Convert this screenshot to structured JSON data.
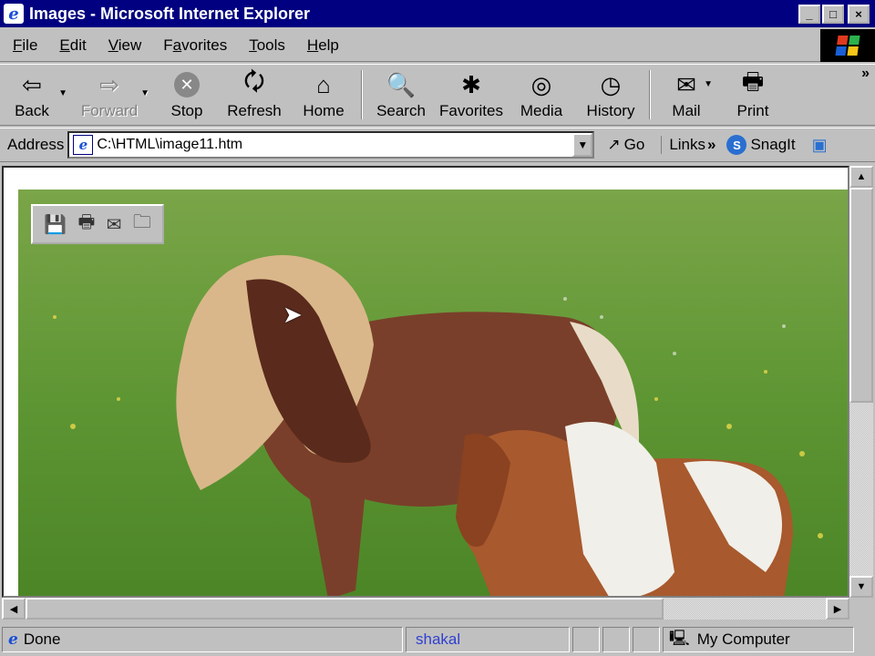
{
  "window": {
    "title": "Images - Microsoft Internet Explorer",
    "min": "_",
    "max": "□",
    "close": "×"
  },
  "menu": [
    {
      "label": "File",
      "u": "F"
    },
    {
      "label": "Edit",
      "u": "E"
    },
    {
      "label": "View",
      "u": "V"
    },
    {
      "label": "Favorites",
      "u": "a"
    },
    {
      "label": "Tools",
      "u": "T"
    },
    {
      "label": "Help",
      "u": "H"
    }
  ],
  "toolbar": {
    "back": "Back",
    "forward": "Forward",
    "stop": "Stop",
    "refresh": "Refresh",
    "home": "Home",
    "search": "Search",
    "favorites": "Favorites",
    "media": "Media",
    "history": "History",
    "mail": "Mail",
    "print": "Print",
    "more": "»"
  },
  "address": {
    "label": "Address",
    "value": "C:\\HTML\\image11.htm",
    "go": "Go",
    "links": "Links",
    "links_more": "»",
    "snagit": "SnagIt"
  },
  "status": {
    "text": "Done",
    "center": "shakal",
    "zone": "My Computer"
  },
  "colors": {
    "titlebar": "#000080",
    "face": "#c0c0c0"
  }
}
